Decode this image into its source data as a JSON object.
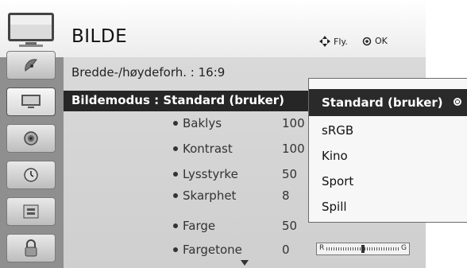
{
  "header": {
    "title": "BILDE",
    "hint_nav": "Fly.",
    "hint_ok": "OK"
  },
  "sidebar": {
    "items": [
      {
        "icon": "satellite-dish-icon"
      },
      {
        "icon": "tv-screen-icon",
        "active": true
      },
      {
        "icon": "speaker-icon"
      },
      {
        "icon": "clock-icon"
      },
      {
        "icon": "option-box-icon"
      },
      {
        "icon": "lock-icon"
      }
    ]
  },
  "list": {
    "aspect_row": "Bredde-/høydeforh. : 16:9",
    "mode_row": "Bildemodus : Standard (bruker)",
    "settings": [
      {
        "label": "Baklys",
        "value": "100"
      },
      {
        "label": "Kontrast",
        "value": "100"
      },
      {
        "label": "Lysstyrke",
        "value": "50"
      },
      {
        "label": "Skarphet",
        "value": "8"
      },
      {
        "label": "Farge",
        "value": "50"
      },
      {
        "label": "Fargetone",
        "value": "0"
      }
    ],
    "balance": {
      "left": "R",
      "right": "G",
      "level": 0.5
    }
  },
  "popup": {
    "options": [
      {
        "label": "Standard (bruker)",
        "selected": true
      },
      {
        "label": "sRGB"
      },
      {
        "label": "Kino"
      },
      {
        "label": "Sport"
      },
      {
        "label": "Spill"
      }
    ]
  },
  "colors": {
    "selected_bg": "#262626",
    "panel_bg": "#d6d6d6",
    "sidebar_bg": "#8f8f8f"
  }
}
